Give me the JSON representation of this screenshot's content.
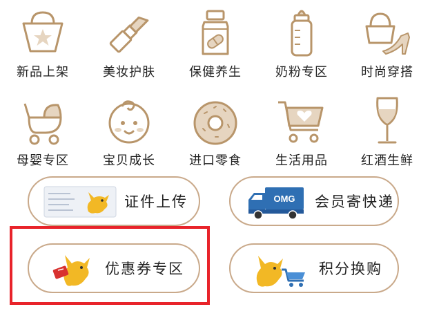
{
  "categories": [
    {
      "label": "新品上架",
      "icon": "shopping-bag-star-icon"
    },
    {
      "label": "美妆护肤",
      "icon": "lipstick-icon"
    },
    {
      "label": "保健养生",
      "icon": "pill-bottle-icon"
    },
    {
      "label": "奶粉专区",
      "icon": "baby-bottle-icon"
    },
    {
      "label": "时尚穿搭",
      "icon": "handbag-heel-icon"
    },
    {
      "label": "母婴专区",
      "icon": "stroller-icon"
    },
    {
      "label": "宝贝成长",
      "icon": "baby-face-icon"
    },
    {
      "label": "进口零食",
      "icon": "donut-icon"
    },
    {
      "label": "生活用品",
      "icon": "shopping-cart-heart-icon"
    },
    {
      "label": "红酒生鲜",
      "icon": "wine-glass-icon"
    }
  ],
  "services": {
    "id_upload": "证件上传",
    "member_express": "会员寄快递",
    "truck_brand": "OMG",
    "coupons": "优惠券专区",
    "points_exchange": "积分换购"
  },
  "colors": {
    "icon_stroke": "#b8956a",
    "icon_fill": "#e6d5c0",
    "pill_border": "#c9a98a",
    "highlight_border": "#e8232a",
    "truck_blue": "#2f6fb3",
    "kangaroo_yellow": "#f2b825"
  }
}
